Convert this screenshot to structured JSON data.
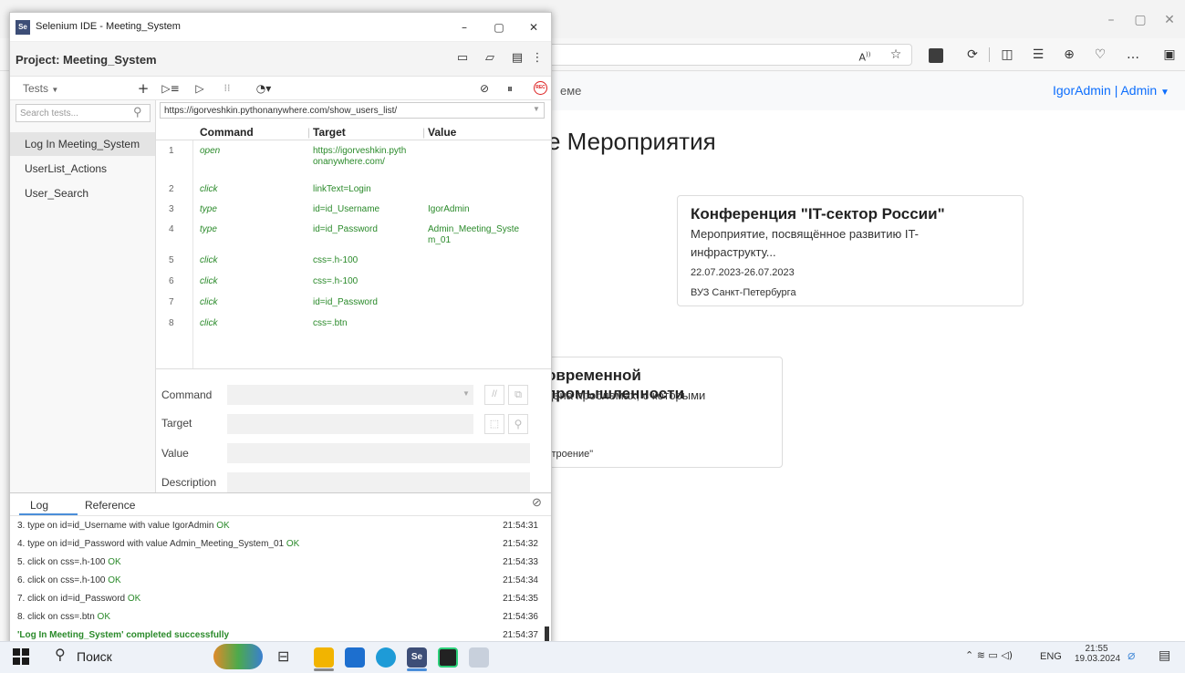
{
  "selenium": {
    "window_title": "Selenium IDE - Meeting_System",
    "project_label": "Project:  Meeting_System",
    "tests_label": "Tests",
    "search_placeholder": "Search tests...",
    "tests": [
      "Log In Meeting_System",
      "UserList_Actions",
      "User_Search"
    ],
    "url": "https://igorveshkin.pythonanywhere.com/show_users_list/",
    "columns": [
      "Command",
      "Target",
      "Value"
    ],
    "commands": [
      {
        "n": "1",
        "cmd": "open",
        "target": "https://igorveshkin.pyth onanywhere.com/",
        "value": ""
      },
      {
        "n": "2",
        "cmd": "click",
        "target": "linkText=Login",
        "value": ""
      },
      {
        "n": "3",
        "cmd": "type",
        "target": "id=id_Username",
        "value": "IgorAdmin"
      },
      {
        "n": "4",
        "cmd": "type",
        "target": "id=id_Password",
        "value": "Admin_Meeting_Syste m_01"
      },
      {
        "n": "5",
        "cmd": "click",
        "target": "css=.h-100",
        "value": ""
      },
      {
        "n": "6",
        "cmd": "click",
        "target": "css=.h-100",
        "value": ""
      },
      {
        "n": "7",
        "cmd": "click",
        "target": "id=id_Password",
        "value": ""
      },
      {
        "n": "8",
        "cmd": "click",
        "target": "css=.btn",
        "value": ""
      }
    ],
    "form_labels": {
      "command": "Command",
      "target": "Target",
      "value": "Value",
      "description": "Description"
    },
    "log_tabs": [
      "Log",
      "Reference"
    ],
    "log": [
      {
        "pre": "3.  type on id=id_Username with value IgorAdmin ",
        "ok": "OK",
        "time": "21:54:31"
      },
      {
        "pre": "4.  type on id=id_Password with value Admin_Meeting_System_01 ",
        "ok": "OK",
        "time": "21:54:32"
      },
      {
        "pre": "5.  click on css=.h-100 ",
        "ok": "OK",
        "time": "21:54:33"
      },
      {
        "pre": "6.  click on css=.h-100 ",
        "ok": "OK",
        "time": "21:54:34"
      },
      {
        "pre": "7.  click on id=id_Password ",
        "ok": "OK",
        "time": "21:54:35"
      },
      {
        "pre": "8.  click on css=.btn ",
        "ok": "OK",
        "time": "21:54:36"
      }
    ],
    "log_done": "'Log In Meeting_System' completed successfully",
    "log_done_time": "21:54:37",
    "rec_label": "REC"
  },
  "site": {
    "nav_partial": "еме",
    "user_menu": "IgorAdmin | Admin",
    "heading_partial": "е Мероприятия",
    "card1": {
      "title": "Конференция \"IT-сектор России\"",
      "desc1": "Мероприятие, посвящённое развитию IT-",
      "desc2": "инфраструкту...",
      "dates": "22.07.2023-26.07.2023",
      "place": "ВУЗ Санкт-Петербурга"
    },
    "card2": {
      "title_partial": "овременной промышленности",
      "desc_partial": "цена проблемах, с которыми",
      "place_partial": "строение\""
    }
  },
  "taskbar": {
    "search_label": "Поиск",
    "lang": "ENG",
    "time": "21:55",
    "date": "19.03.2024"
  }
}
